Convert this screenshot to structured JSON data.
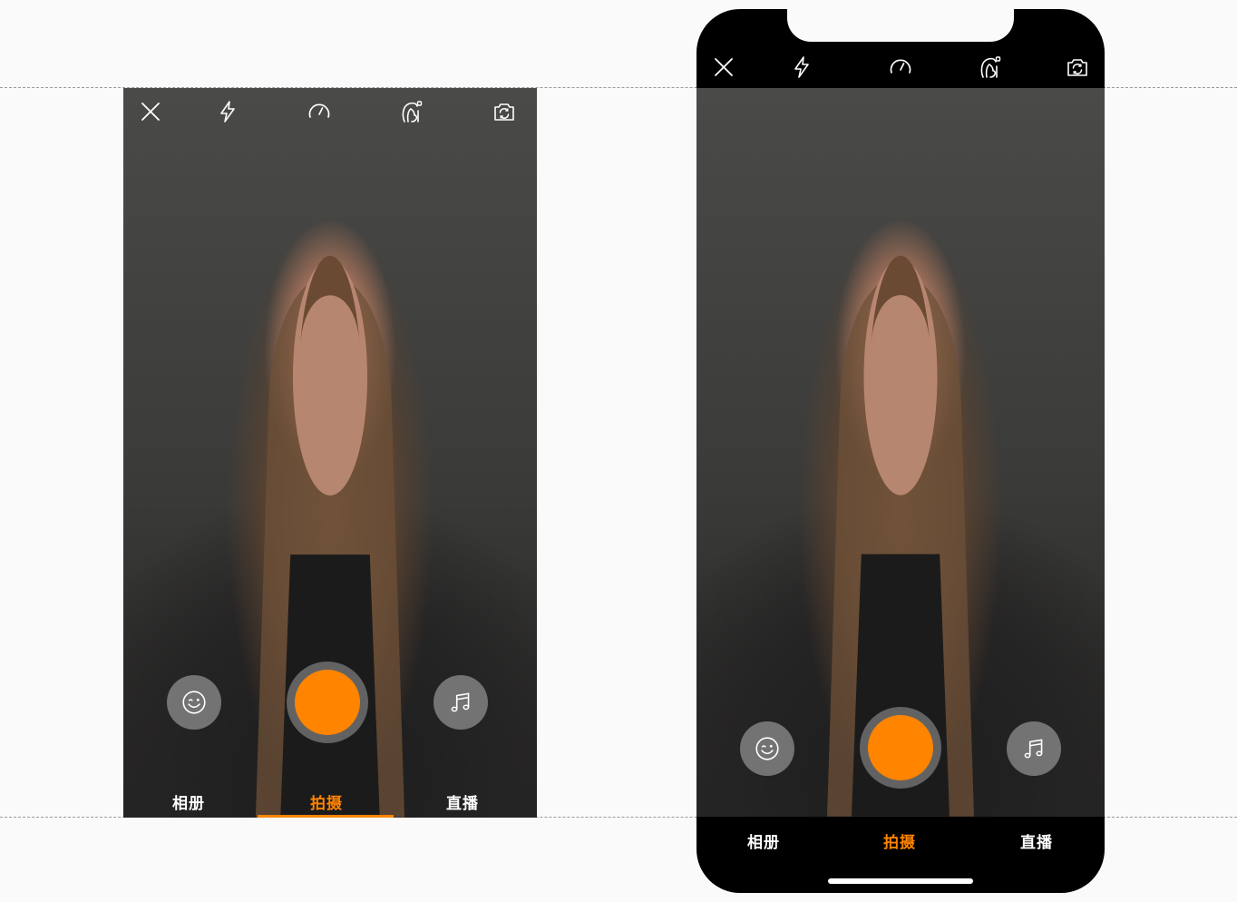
{
  "colors": {
    "accent": "#ff8400",
    "icon": "#ffffff",
    "bar": "#000000"
  },
  "screens": [
    {
      "id": "framed",
      "top_icons": [
        "close-icon",
        "flash-icon",
        "speed-icon",
        "beauty-icon",
        "flip-camera-icon"
      ],
      "buttons": [
        "sticker-icon",
        "shutter",
        "music-icon"
      ],
      "tabs": [
        {
          "label": "相册"
        },
        {
          "label": "拍摄",
          "active": true
        },
        {
          "label": "直播"
        }
      ]
    },
    {
      "id": "full-screen",
      "top_icons": [
        "close-icon",
        "flash-icon",
        "speed-icon",
        "beauty-icon",
        "flip-camera-icon"
      ],
      "buttons": [
        "sticker-icon",
        "shutter",
        "music-icon"
      ],
      "tabs": [
        {
          "label": "相册"
        },
        {
          "label": "拍摄",
          "active": true
        },
        {
          "label": "直播"
        }
      ]
    }
  ]
}
